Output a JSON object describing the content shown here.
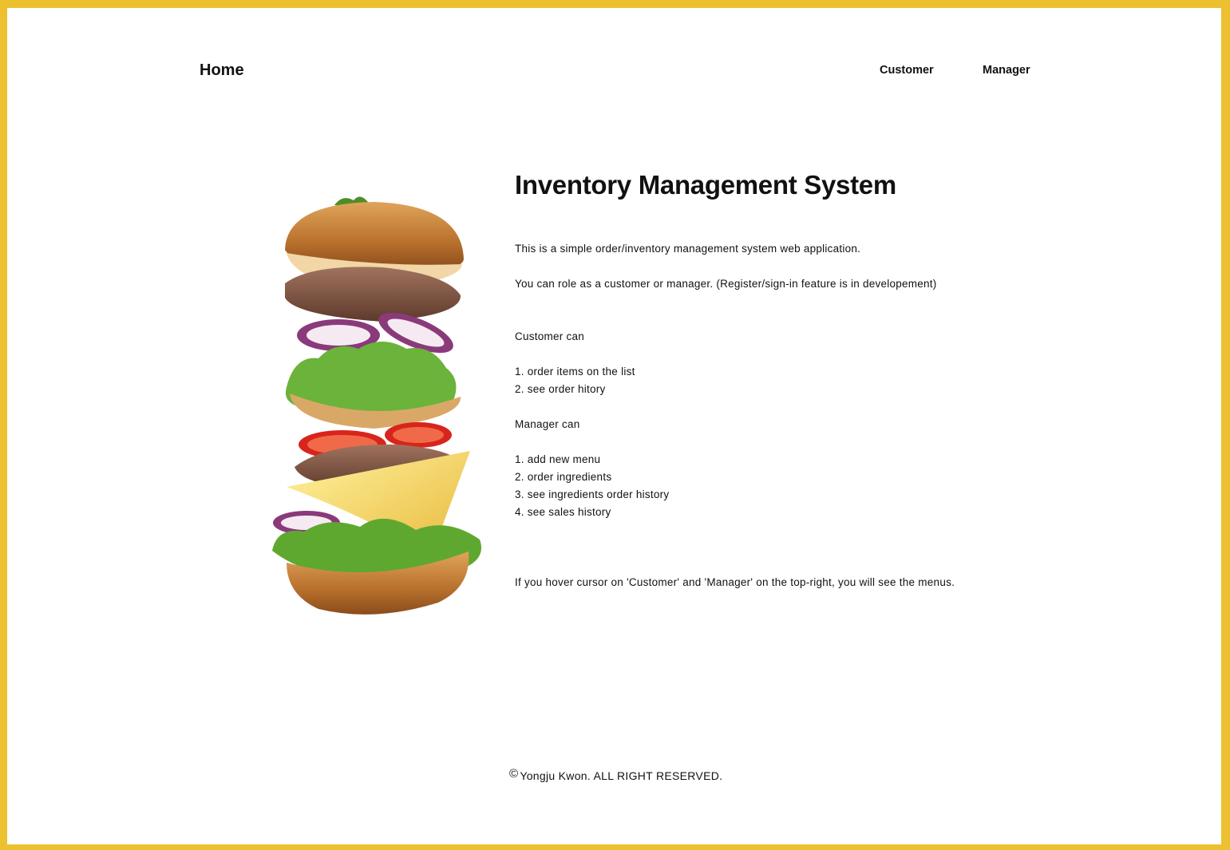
{
  "nav": {
    "home_label": "Home",
    "customer_label": "Customer",
    "manager_label": "Manager"
  },
  "main": {
    "title": "Inventory Management System",
    "intro": "This is a simple order/inventory management system web application.",
    "role_note": "You can role as a customer or manager. (Register/sign-in feature is in developement)",
    "customer_heading": "Customer can",
    "customer_items": [
      "1. order items on the list",
      "2. see order hitory"
    ],
    "manager_heading": "Manager can",
    "manager_items": [
      "1. add new menu",
      "2. order ingredients",
      "3. see ingredients order history",
      "4. see sales history"
    ],
    "hover_note": "If you hover cursor on 'Customer' and 'Manager' on the top-right, you will see the menus."
  },
  "hero_image": {
    "icon": "burger-image"
  },
  "footer": {
    "copyright_symbol": "©",
    "text": "Yongju Kwon. ALL RIGHT RESERVED."
  },
  "colors": {
    "frame": "#ecc02f",
    "background": "#ffffff",
    "text": "#111111"
  }
}
